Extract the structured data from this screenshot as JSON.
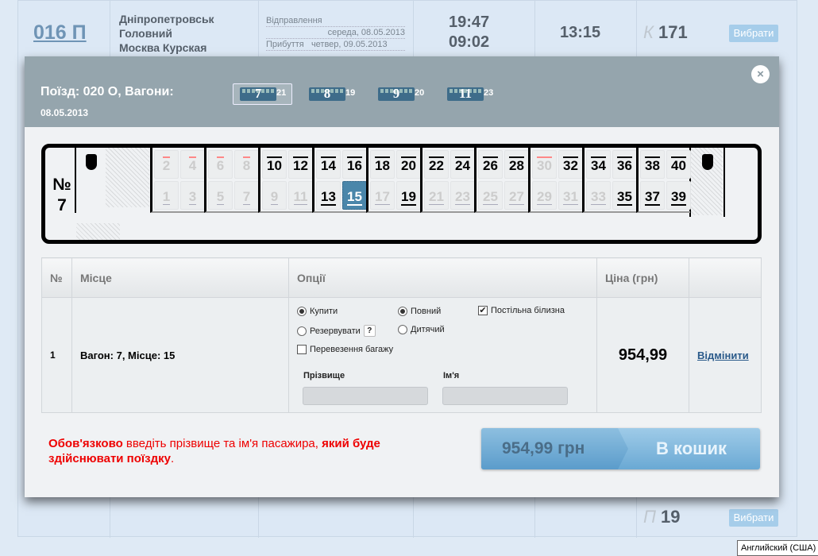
{
  "background": {
    "train_number": "016 П",
    "stations": [
      "Дніпропетровськ",
      "Головний",
      "Москва Курская"
    ],
    "departure_label": "Відправлення",
    "departure_date": "середа, 08.05.2013",
    "arrival_label": "Прибуття",
    "arrival_date": "четвер, 09.05.2013",
    "times": [
      "19:47",
      "09:02"
    ],
    "duration": "13:15",
    "rows": [
      {
        "class": "К",
        "seats": "171",
        "button": "Вибрати"
      },
      {
        "class": "П",
        "seats": "19",
        "button": "Вибрати"
      }
    ]
  },
  "modal": {
    "title": "Поїзд: 020 О, Вагони:",
    "date": "08.05.2013",
    "close": "×",
    "wagons": [
      {
        "number": "7",
        "seats": "21",
        "selected": true
      },
      {
        "number": "8",
        "seats": "19"
      },
      {
        "number": "9",
        "seats": "20"
      },
      {
        "number": "11",
        "seats": "23"
      }
    ],
    "car_label": "№ 7",
    "seats": [
      {
        "top": {
          "n": "2",
          "s": "red"
        },
        "bot": {
          "n": "1",
          "s": "na"
        }
      },
      {
        "top": {
          "n": "4",
          "s": "red"
        },
        "bot": {
          "n": "3",
          "s": "na"
        }
      },
      {
        "top": {
          "n": "6",
          "s": "red"
        },
        "bot": {
          "n": "5",
          "s": "na"
        }
      },
      {
        "top": {
          "n": "8",
          "s": "red"
        },
        "bot": {
          "n": "7",
          "s": "na"
        }
      },
      {
        "top": {
          "n": "10",
          "s": "av"
        },
        "bot": {
          "n": "9",
          "s": "na"
        }
      },
      {
        "top": {
          "n": "12",
          "s": "av"
        },
        "bot": {
          "n": "11",
          "s": "na"
        }
      },
      {
        "top": {
          "n": "14",
          "s": "av"
        },
        "bot": {
          "n": "13",
          "s": "av"
        }
      },
      {
        "top": {
          "n": "16",
          "s": "av"
        },
        "bot": {
          "n": "15",
          "s": "sel"
        }
      },
      {
        "top": {
          "n": "18",
          "s": "av"
        },
        "bot": {
          "n": "17",
          "s": "na"
        }
      },
      {
        "top": {
          "n": "20",
          "s": "av"
        },
        "bot": {
          "n": "19",
          "s": "av"
        }
      },
      {
        "top": {
          "n": "22",
          "s": "av"
        },
        "bot": {
          "n": "21",
          "s": "na"
        }
      },
      {
        "top": {
          "n": "24",
          "s": "av"
        },
        "bot": {
          "n": "23",
          "s": "na"
        }
      },
      {
        "top": {
          "n": "26",
          "s": "av"
        },
        "bot": {
          "n": "25",
          "s": "na"
        }
      },
      {
        "top": {
          "n": "28",
          "s": "av"
        },
        "bot": {
          "n": "27",
          "s": "na"
        }
      },
      {
        "top": {
          "n": "30",
          "s": "red"
        },
        "bot": {
          "n": "29",
          "s": "na"
        }
      },
      {
        "top": {
          "n": "32",
          "s": "av"
        },
        "bot": {
          "n": "31",
          "s": "na"
        }
      },
      {
        "top": {
          "n": "34",
          "s": "av"
        },
        "bot": {
          "n": "33",
          "s": "na"
        }
      },
      {
        "top": {
          "n": "36",
          "s": "av"
        },
        "bot": {
          "n": "35",
          "s": "av"
        }
      },
      {
        "top": {
          "n": "38",
          "s": "av"
        },
        "bot": {
          "n": "37",
          "s": "av"
        }
      },
      {
        "top": {
          "n": "40",
          "s": "av"
        },
        "bot": {
          "n": "39",
          "s": "av"
        }
      }
    ],
    "table": {
      "headers": [
        "№",
        "Місце",
        "Опції",
        "Ціна (грн)"
      ],
      "row": {
        "no": "1",
        "place": "Вагон: 7, Місце: 15",
        "price": "954,99",
        "cancel": "Відмінити"
      },
      "options": {
        "buy": "Купити",
        "reserve": "Резервувати",
        "help": "?",
        "full": "Повний",
        "child": "Дитячий",
        "linen": "Постільна білизна",
        "baggage": "Перевезення багажу",
        "surname_label": "Прізвище",
        "name_label": "Ім'я",
        "surname": "",
        "name": ""
      }
    },
    "warning": {
      "a": "Обов'язково",
      "b": " введіть прізвище та ім'я пасажира, ",
      "c": "який буде здійснювати поїздку",
      "d": "."
    },
    "cart": {
      "price": "954,99 грн",
      "button": "В кошик"
    }
  },
  "tooltip": "Английский (США)"
}
